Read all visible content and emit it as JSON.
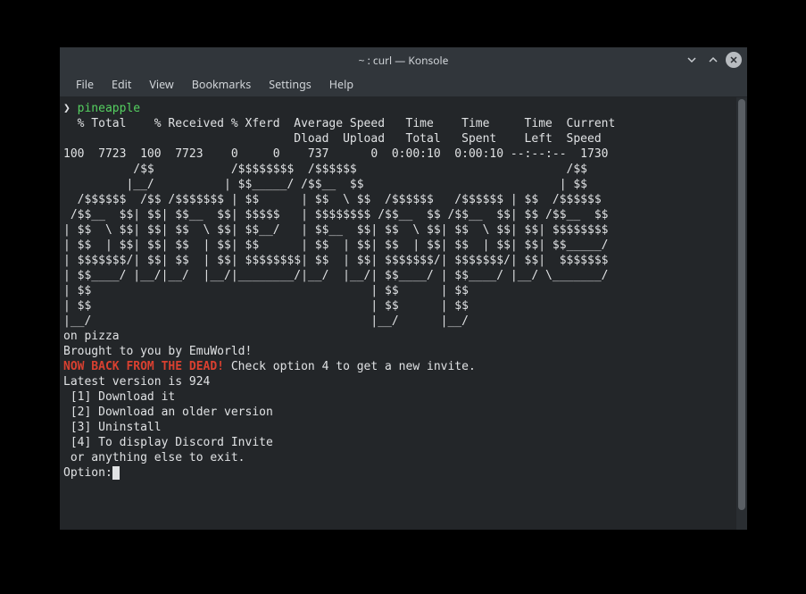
{
  "window": {
    "title": "~ : curl — Konsole"
  },
  "menubar": {
    "items": [
      "File",
      "Edit",
      "View",
      "Bookmarks",
      "Settings",
      "Help"
    ]
  },
  "terminal": {
    "prompt_char": "❯",
    "command": "pineapple",
    "curl_header": "  % Total    % Received % Xferd  Average Speed   Time    Time     Time  Current\n                                 Dload  Upload   Total   Spent    Left  Speed\n100  7723  100  7723    0     0    737      0  0:00:10  0:00:10 --:--:--  1730",
    "ascii_art": "          /$$           /$$$$$$$$  /$$$$$$                              /$$\n         |__/          | $$_____/ /$$__  $$                            | $$\n  /$$$$$$  /$$ /$$$$$$$ | $$      | $$  \\ $$  /$$$$$$   /$$$$$$ | $$  /$$$$$$\n /$$__  $$| $$| $$__  $$| $$$$$   | $$$$$$$$ /$$__  $$ /$$__  $$| $$ /$$__  $$\n| $$  \\ $$| $$| $$  \\ $$| $$__/   | $$__  $$| $$  \\ $$| $$  \\ $$| $$| $$$$$$$$\n| $$  | $$| $$| $$  | $$| $$      | $$  | $$| $$  | $$| $$  | $$| $$| $$_____/\n| $$$$$$$/| $$| $$  | $$| $$$$$$$$| $$  | $$| $$$$$$$/| $$$$$$$/| $$|  $$$$$$$\n| $$____/ |__/|__/  |__/|________/|__/  |__/| $$____/ | $$____/ |__/ \\_______/\n| $$                                        | $$      | $$\n| $$                                        | $$      | $$\n|__/                                        |__/      |__/",
    "on_pizza": "on pizza",
    "brought_by": "Brought to you by EmuWorld!",
    "now_back": "NOW BACK FROM THE DEAD!",
    "check_option": " Check option 4 to get a new invite.",
    "latest_version": "Latest version is 924",
    "options": [
      " [1] Download it",
      " [2] Download an older version",
      " [3] Uninstall",
      " [4] To display Discord Invite",
      " or anything else to exit."
    ],
    "option_prompt": "Option:"
  }
}
